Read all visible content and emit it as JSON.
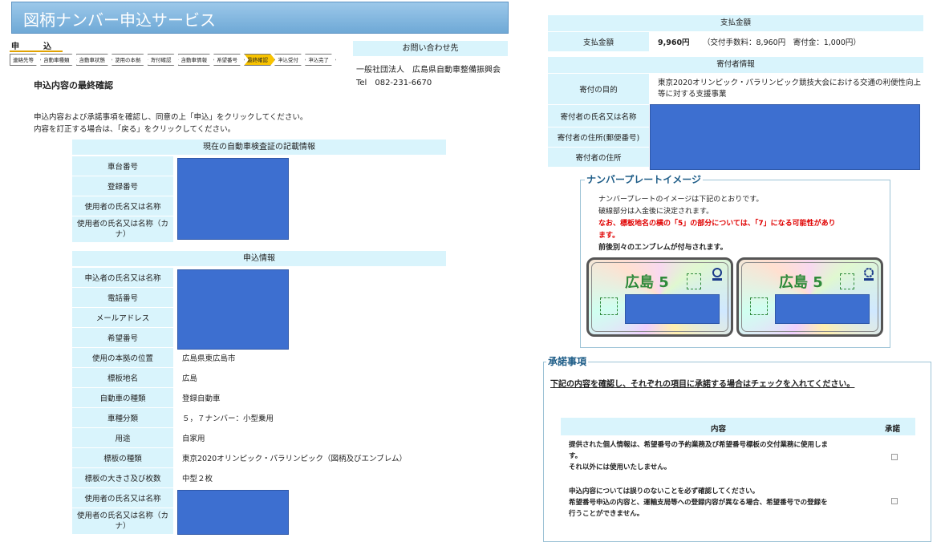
{
  "header": {
    "title": "図柄ナンバー申込サービス",
    "section": "申込",
    "steps": [
      "連絡先等",
      "自動車種類",
      "自動車状態",
      "使用の本拠",
      "寄付確認",
      "自動車情報",
      "希望番号",
      "最終確認",
      "申込受付",
      "申込完了"
    ],
    "active_step": "最終確認"
  },
  "contact": {
    "heading": "お問い合わせ先",
    "org": "一般社団法人　広島県自動車整備振興会",
    "tel": "Tel　082-231-6670"
  },
  "main": {
    "title": "申込内容の最終確認",
    "instruction1": "申込内容および承諾事項を確認し、同意の上「申込」をクリックしてください。",
    "instruction2": "内容を訂正する場合は、「戻る」をクリックしてください。"
  },
  "vehicle_cert": {
    "heading": "現在の自動車検査証の記載情報",
    "labels": [
      "車台番号",
      "登録番号",
      "使用者の氏名又は名称",
      "使用者の氏名又は名称（カナ）"
    ]
  },
  "application": {
    "heading": "申込情報",
    "redacted_labels": [
      "申込者の氏名又は名称",
      "電話番号",
      "メールアドレス",
      "希望番号"
    ],
    "rows": [
      {
        "label": "使用の本拠の位置",
        "value": "広島県東広島市"
      },
      {
        "label": "標板地名",
        "value": "広島"
      },
      {
        "label": "自動車の種類",
        "value": "登録自動車"
      },
      {
        "label": "車種分類",
        "value": "５，７ナンバー：小型乗用"
      },
      {
        "label": "用途",
        "value": "自家用"
      },
      {
        "label": "標板の種類",
        "value": "東京2020オリンピック・パラリンピック（図柄及びエンブレム）"
      },
      {
        "label": "標板の大きさ及び枚数",
        "value": "中型２枚"
      }
    ],
    "user_labels": [
      "使用者の氏名又は名称",
      "使用者の氏名又は名称（カナ）"
    ]
  },
  "payment": {
    "heading": "支払金額",
    "label": "支払金額",
    "amount": "9,960円",
    "detail": "（交付手数料：8,960円　寄付金：1,000円）"
  },
  "donor": {
    "heading": "寄付者情報",
    "purpose_label": "寄付の目的",
    "purpose_value": "東京2020オリンピック・パラリンピック競技大会における交通の利便性向上等に対する支援事業",
    "labels": [
      "寄付者の氏名又は名称",
      "寄付者の住所(郵便番号)",
      "寄付者の住所"
    ]
  },
  "plate_image": {
    "legend": "ナンバープレートイメージ",
    "line1": "ナンバープレートのイメージは下記のとおりです。",
    "line2": "破線部分は入金後に決定されます。",
    "warning1": "なお、標板地名の横の「5」の部分については、「7」になる可能性があり",
    "warning2": "ます。",
    "note": "前後別々のエンブレムが付与されます。",
    "plate_text": "広島 5",
    "plate_text2": "広島 5"
  },
  "consent": {
    "legend": "承諾事項",
    "instruction": "下記の内容を確認し、それぞれの項目に承諾する場合はチェックを入れてください。",
    "col_content": "内容",
    "col_consent": "承諾",
    "items": [
      {
        "lines": [
          "提供された個人情報は、希望番号の予約業務及び希望番号標板の交付業務に使用しま",
          "す。",
          "それ以外には使用いたしません。"
        ]
      },
      {
        "lines": [
          "申込内容については誤りのないことを必ず確認してください。",
          "希望番号申込の内容と、運輸支局等への登録内容が異なる場合、希望番号での登録を",
          "行うことができません。"
        ]
      }
    ]
  }
}
